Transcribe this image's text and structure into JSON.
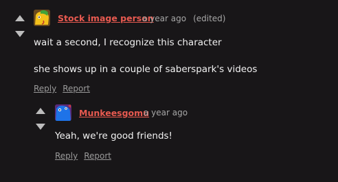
{
  "comments": [
    {
      "username": "Stock image person",
      "timestamp": "a year ago",
      "edited": "(edited)",
      "paragraphs": [
        "wait a second, I recognize this character",
        "she shows up in a couple of saberspark's videos"
      ],
      "reply_label": "Reply",
      "report_label": "Report",
      "avatar_icon": "yellow-green-creature-avatar"
    },
    {
      "username": "Munkeesgomu",
      "timestamp": "a year ago",
      "paragraphs": [
        "Yeah, we're good friends!"
      ],
      "reply_label": "Reply",
      "report_label": "Report",
      "avatar_icon": "blue-creature-avatar"
    }
  ],
  "colors": {
    "background": "#181618",
    "username": "#e85a50",
    "meta": "#a7a7a7",
    "text": "#f2f2f2"
  }
}
